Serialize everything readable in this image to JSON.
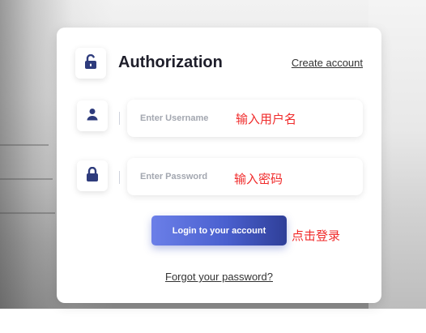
{
  "header": {
    "title": "Authorization",
    "create_account": "Create account",
    "icon": "lock-open-icon"
  },
  "fields": {
    "username": {
      "placeholder": "Enter Username",
      "value": "",
      "icon": "user-icon",
      "annotation": "输入用户名"
    },
    "password": {
      "placeholder": "Enter Password",
      "value": "",
      "icon": "lock-icon",
      "annotation": "输入密码"
    }
  },
  "login": {
    "label": "Login to your account",
    "annotation": "点击登录"
  },
  "forgot_password": "Forgot your password?",
  "colors": {
    "icon": "#2e3b7c",
    "button_start": "#6b7fe8",
    "button_end": "#2f3f98",
    "annotation": "#f02a2a",
    "title": "#1e1e2a"
  }
}
